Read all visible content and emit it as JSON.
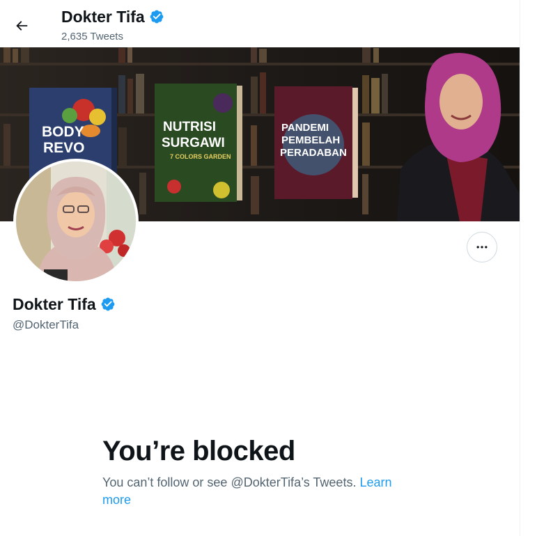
{
  "header": {
    "name": "Dokter Tifa",
    "tweet_count": "2,635 Tweets"
  },
  "banner": {
    "book1": {
      "line1": "BODY",
      "line2": "REVO"
    },
    "book2": {
      "line1": "NUTRISI",
      "line2": "SURGAWI",
      "line3": "7 COLORS GARDEN"
    },
    "book3": {
      "line1": "PANDEMI",
      "line2": "PEMBELAH",
      "line3": "PERADABAN"
    }
  },
  "profile": {
    "name": "Dokter Tifa",
    "handle": "@DokterTifa"
  },
  "blocked": {
    "title": "You’re blocked",
    "description": "You can’t follow or see @DokterTifa’s Tweets.",
    "learn_more": "Learn more"
  },
  "colors": {
    "accent": "#1d9bf0",
    "text_primary": "#0f1419",
    "text_secondary": "#536471",
    "border": "#cfd9de"
  },
  "icons": {
    "back": "arrow-left-icon",
    "verified": "verified-badge-icon",
    "more": "more-dots-icon"
  }
}
